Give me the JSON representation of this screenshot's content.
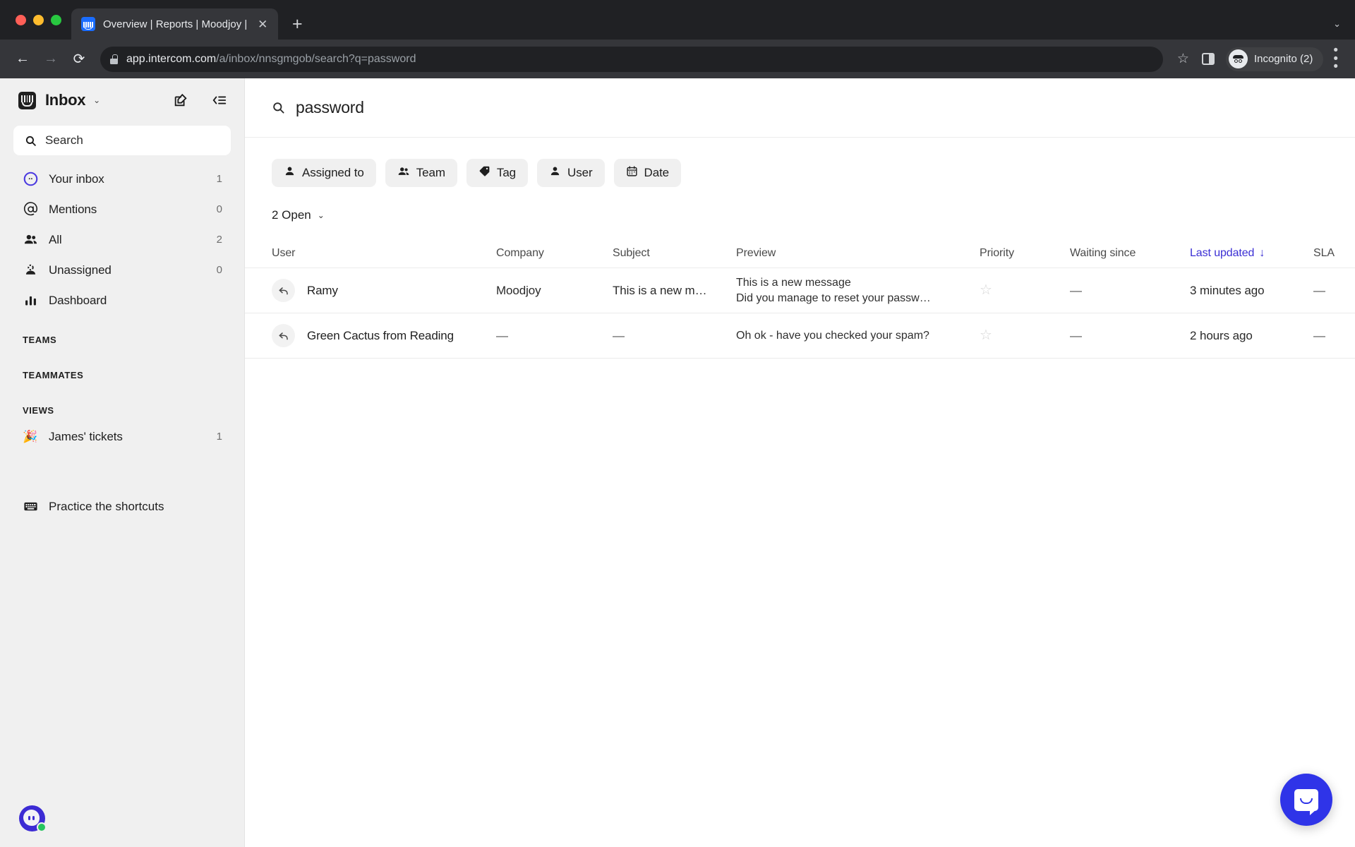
{
  "browser": {
    "tab": {
      "title": "Overview | Reports | Moodjoy |",
      "favicon": "intercom-favicon",
      "close_label": "✕"
    },
    "new_tab_label": "+",
    "tabstrip_caret": "⌄",
    "back_label": "←",
    "forward_label": "→",
    "reload_label": "⟳",
    "url_domain": "app.intercom.com",
    "url_path": "/a/inbox/nnsgmgob/search?q=password",
    "bookmark_label": "☆",
    "profile_label": "Incognito (2)",
    "menu_label": "⋮"
  },
  "sidebar": {
    "title": "Inbox",
    "caret": "⌄",
    "compose_icon": "compose-icon",
    "collapse_icon": "collapse-sidebar-icon",
    "search": {
      "placeholder": "Search",
      "icon": "search-icon"
    },
    "nav": [
      {
        "label": "Your inbox",
        "count": "1",
        "icon": "your-inbox-icon"
      },
      {
        "label": "Mentions",
        "count": "0",
        "icon": "mentions-icon"
      },
      {
        "label": "All",
        "count": "2",
        "icon": "all-icon"
      },
      {
        "label": "Unassigned",
        "count": "0",
        "icon": "unassigned-icon"
      },
      {
        "label": "Dashboard",
        "count": "",
        "icon": "dashboard-icon"
      }
    ],
    "sections": [
      {
        "label": "TEAMS",
        "items": []
      },
      {
        "label": "TEAMMATES",
        "items": []
      },
      {
        "label": "VIEWS",
        "items": [
          {
            "label": "James' tickets",
            "count": "1",
            "icon": "party-popper-icon"
          }
        ]
      }
    ],
    "practice": {
      "label": "Practice the shortcuts",
      "icon": "keyboard-icon"
    },
    "avatar": {
      "name": "avatar",
      "status": "online"
    }
  },
  "search_header": {
    "query": "password",
    "icon": "search-icon"
  },
  "filters": [
    {
      "label": "Assigned to",
      "icon": "person-icon"
    },
    {
      "label": "Team",
      "icon": "people-icon"
    },
    {
      "label": "Tag",
      "icon": "tag-icon"
    },
    {
      "label": "User",
      "icon": "person-icon"
    },
    {
      "label": "Date",
      "icon": "calendar-icon"
    }
  ],
  "status_filter": {
    "label": "2 Open",
    "caret": "⌄"
  },
  "table": {
    "columns": [
      {
        "key": "user",
        "label": "User",
        "sorted": false
      },
      {
        "key": "company",
        "label": "Company",
        "sorted": false
      },
      {
        "key": "subject",
        "label": "Subject",
        "sorted": false
      },
      {
        "key": "preview",
        "label": "Preview",
        "sorted": false
      },
      {
        "key": "priority",
        "label": "Priority",
        "sorted": false
      },
      {
        "key": "waiting",
        "label": "Waiting since",
        "sorted": false
      },
      {
        "key": "updated",
        "label": "Last updated",
        "sorted": true,
        "sort_arrow": "↓"
      },
      {
        "key": "sla",
        "label": "SLA",
        "sorted": false
      }
    ],
    "rows": [
      {
        "icon": "reply-icon",
        "user": "Ramy",
        "company": "Moodjoy",
        "subject": "This is a new m…",
        "preview_line1": "This is a new message",
        "preview_line2": "Did you manage to reset your passw…",
        "priority": "☆",
        "waiting": "—",
        "updated": "3 minutes ago",
        "sla": "—"
      },
      {
        "icon": "reply-icon",
        "user": "Green Cactus from Reading",
        "company": "—",
        "subject": "—",
        "preview_line1": "Oh ok - have you checked your spam?",
        "preview_line2": "",
        "priority": "☆",
        "waiting": "—",
        "updated": "2 hours ago",
        "sla": "—"
      }
    ]
  },
  "messenger": {
    "label": "messenger-launcher"
  },
  "colors": {
    "accent": "#3b2fd4",
    "messenger": "#2f34e8",
    "sidebar_bg": "#f0f0f0",
    "chrome_bg": "#202124",
    "online": "#26c55f"
  }
}
